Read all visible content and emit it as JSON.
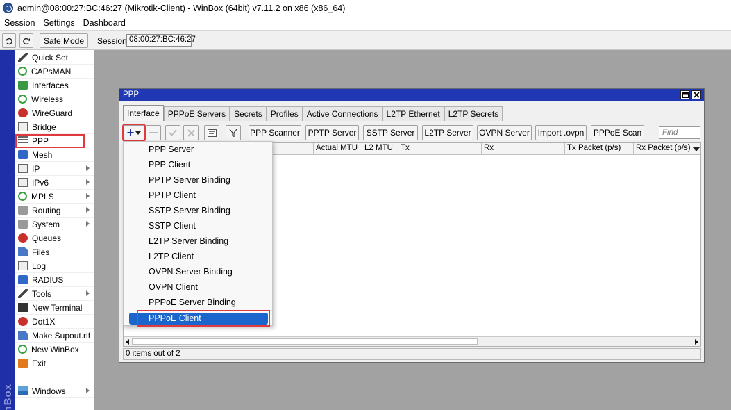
{
  "window_title": "admin@08:00:27:BC:46:27 (Mikrotik-Client) - WinBox (64bit) v7.11.2 on x86 (x86_64)",
  "menubar": [
    "Session",
    "Settings",
    "Dashboard"
  ],
  "toolbar": {
    "safe_mode_label": "Safe Mode",
    "session_label": "Session:",
    "session_value": "08:00:27:BC:46:27"
  },
  "sidebar": {
    "brand_text": "WinBox",
    "items": [
      {
        "label": "Quick Set",
        "icon": "wand-icon",
        "submenu": false
      },
      {
        "label": "CAPsMAN",
        "icon": "capsman-icon",
        "submenu": false
      },
      {
        "label": "Interfaces",
        "icon": "interfaces-icon",
        "submenu": false
      },
      {
        "label": "Wireless",
        "icon": "wireless-icon",
        "submenu": false
      },
      {
        "label": "WireGuard",
        "icon": "wireguard-icon",
        "submenu": false
      },
      {
        "label": "Bridge",
        "icon": "bridge-icon",
        "submenu": false
      },
      {
        "label": "PPP",
        "icon": "ppp-icon",
        "submenu": false,
        "highlighted": true
      },
      {
        "label": "Mesh",
        "icon": "mesh-icon",
        "submenu": false
      },
      {
        "label": "IP",
        "icon": "ip-icon",
        "submenu": true
      },
      {
        "label": "IPv6",
        "icon": "ipv6-icon",
        "submenu": true
      },
      {
        "label": "MPLS",
        "icon": "mpls-icon",
        "submenu": true
      },
      {
        "label": "Routing",
        "icon": "routing-icon",
        "submenu": true
      },
      {
        "label": "System",
        "icon": "system-icon",
        "submenu": true
      },
      {
        "label": "Queues",
        "icon": "queues-icon",
        "submenu": false
      },
      {
        "label": "Files",
        "icon": "files-icon",
        "submenu": false
      },
      {
        "label": "Log",
        "icon": "log-icon",
        "submenu": false
      },
      {
        "label": "RADIUS",
        "icon": "radius-icon",
        "submenu": false
      },
      {
        "label": "Tools",
        "icon": "tools-icon",
        "submenu": true
      },
      {
        "label": "New Terminal",
        "icon": "terminal-icon",
        "submenu": false
      },
      {
        "label": "Dot1X",
        "icon": "dot1x-icon",
        "submenu": false
      },
      {
        "label": "Make Supout.rif",
        "icon": "supout-icon",
        "submenu": false
      },
      {
        "label": "New WinBox",
        "icon": "winbox-icon",
        "submenu": false
      },
      {
        "label": "Exit",
        "icon": "exit-icon",
        "submenu": false
      },
      {
        "label": "Windows",
        "icon": "windows-icon",
        "submenu": true
      }
    ]
  },
  "ppp_window": {
    "title": "PPP",
    "tabs": [
      "Interface",
      "PPPoE Servers",
      "Secrets",
      "Profiles",
      "Active Connections",
      "L2TP Ethernet",
      "L2TP Secrets"
    ],
    "active_tab": "Interface",
    "toolbar_buttons": [
      "PPP Scanner",
      "PPTP Server",
      "SSTP Server",
      "L2TP Server",
      "OVPN Server",
      "Import .ovpn",
      "PPPoE Scan"
    ],
    "find_placeholder": "Find",
    "columns": [
      "Actual MTU",
      "L2 MTU",
      "Tx",
      "Rx",
      "Tx Packet (p/s)",
      "Rx Packet (p/s)"
    ],
    "status": "0 items out of 2"
  },
  "add_menu": {
    "items": [
      "PPP Server",
      "PPP Client",
      "PPTP Server Binding",
      "PPTP Client",
      "SSTP Server Binding",
      "SSTP Client",
      "L2TP Server Binding",
      "L2TP Client",
      "OVPN Server Binding",
      "OVPN Client",
      "PPPoE Server Binding",
      "PPPoE Client"
    ],
    "selected": "PPPoE Client"
  },
  "colors": {
    "window_title_bg": "#2038b4",
    "sidebar_strip": "#1f2fa8",
    "selection": "#1a66cc",
    "highlight_box": "#e0393e",
    "desktop_bg": "#a2a2a2"
  }
}
